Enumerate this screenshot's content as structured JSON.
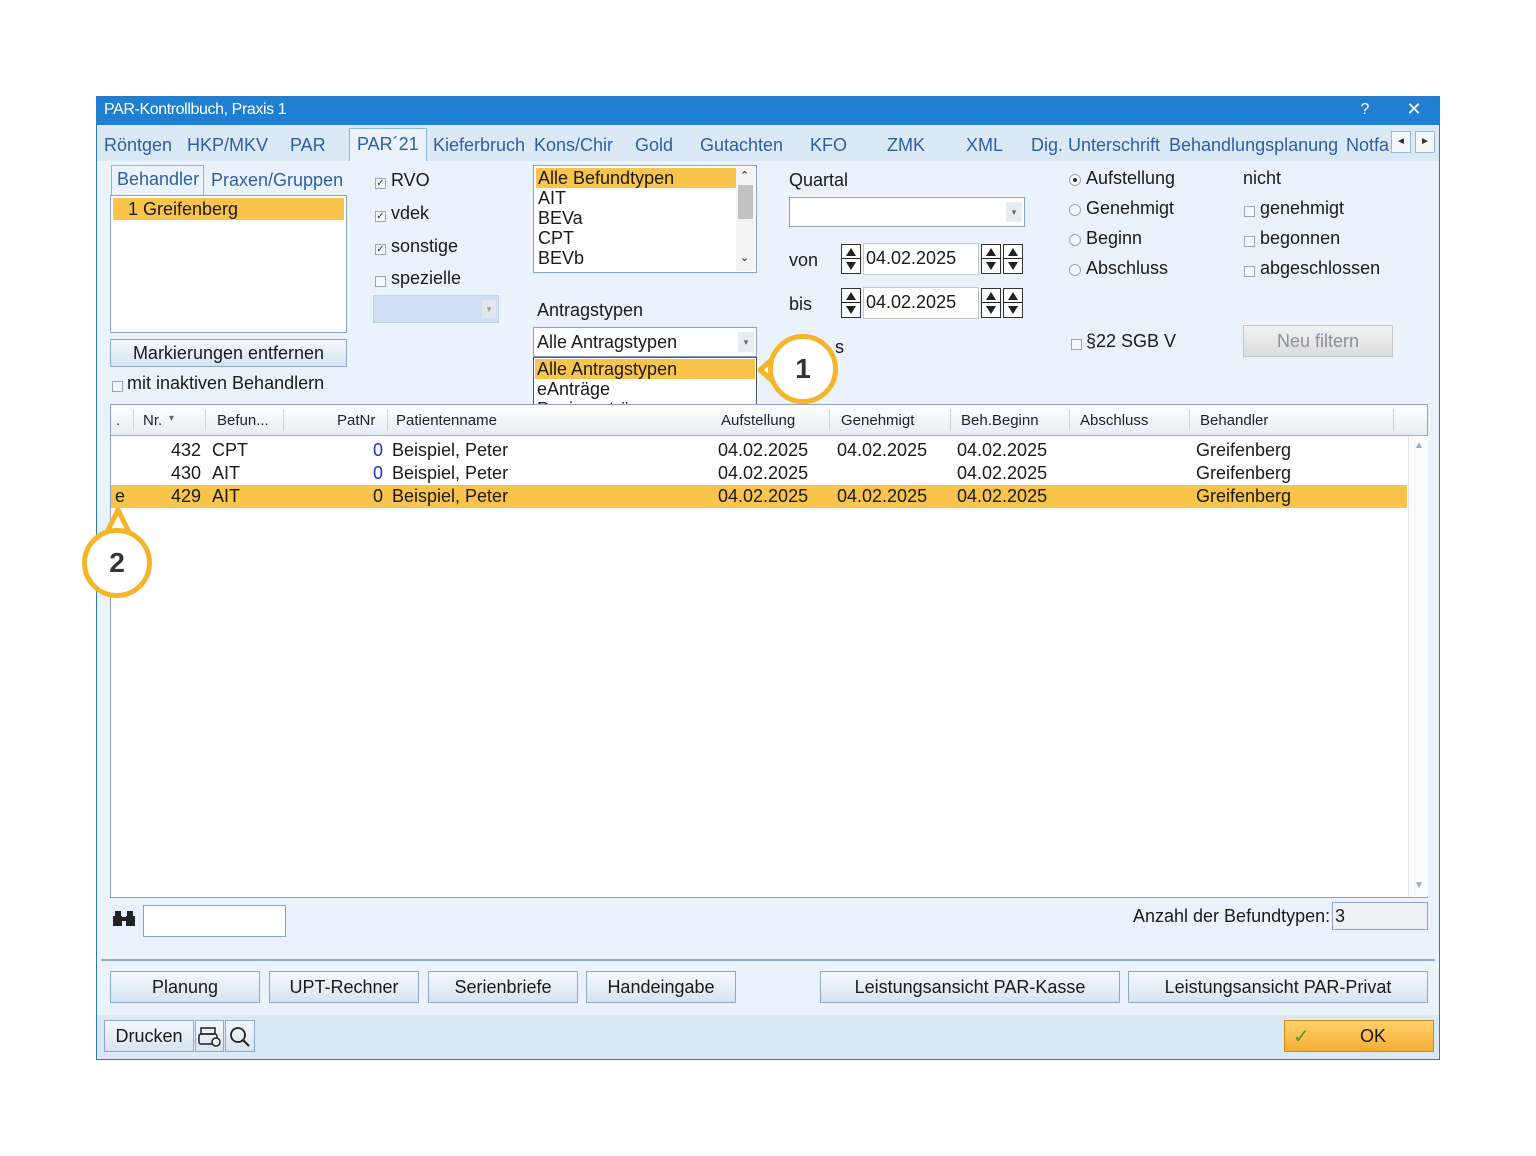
{
  "window": {
    "title": "PAR-Kontrollbuch, Praxis 1",
    "help": "?",
    "close": "✕"
  },
  "tabs": [
    "Röntgen",
    "HKP/MKV",
    "PAR",
    "PAR´21",
    "Kieferbruch",
    "Kons/Chir",
    "Gold",
    "Gutachten",
    "KFO",
    "ZMK",
    "XML",
    "Dig. Unterschrift",
    "Behandlungsplanung",
    "Notfa"
  ],
  "active_tab": "PAR´21",
  "left": {
    "tabs": [
      "Behandler",
      "Praxen/Gruppen"
    ],
    "behandler_list": [
      "1 Greifenberg"
    ],
    "remove_button": "Markierungen entfernen",
    "inactive_checkbox": "mit inaktiven Behandlern"
  },
  "kassen": [
    {
      "label": "RVO",
      "checked": true
    },
    {
      "label": "vdek",
      "checked": true
    },
    {
      "label": "sonstige",
      "checked": true
    },
    {
      "label": "spezielle",
      "checked": false
    }
  ],
  "befundtypen": [
    "Alle Befundtypen",
    "AIT",
    "BEVa",
    "CPT",
    "BEVb"
  ],
  "antragstypen": {
    "label": "Antragstypen",
    "selected": "Alle Antragstypen",
    "options": [
      "Alle Antragstypen",
      "eAnträge",
      "Papieranträge"
    ]
  },
  "zeitraum": {
    "quartal_label": "Quartal",
    "quartal_value": "",
    "von_label": "von",
    "von_value": "04.02.2025",
    "bis_label": "bis",
    "bis_value": "04.02.2025",
    "partial_label": "s"
  },
  "status_radios": [
    {
      "label": "Aufstellung",
      "selected": true
    },
    {
      "label": "Genehmigt",
      "selected": false
    },
    {
      "label": "Beginn",
      "selected": false
    },
    {
      "label": "Abschluss",
      "selected": false
    }
  ],
  "nicht": {
    "label": "nicht",
    "options": [
      "genehmigt",
      "begonnen",
      "abgeschlossen"
    ]
  },
  "sgb_checkbox": "§22 SGB V",
  "filter_button": "Neu filtern",
  "grid": {
    "columns": [
      ".",
      "Nr.",
      "Befun...",
      "PatNr",
      "Patientenname",
      "Aufstellung",
      "Genehmigt",
      "Beh.Beginn",
      "Abschluss",
      "Behandler"
    ],
    "rows": [
      {
        "mark": "",
        "nr": "432",
        "befund": "CPT",
        "patnr": "0",
        "name": "Beispiel, Peter",
        "aufstellung": "04.02.2025",
        "genehmigt": "04.02.2025",
        "beginn": "04.02.2025",
        "abschluss": "",
        "behandler": "Greifenberg",
        "selected": false
      },
      {
        "mark": "",
        "nr": "430",
        "befund": "AIT",
        "patnr": "0",
        "name": "Beispiel, Peter",
        "aufstellung": "04.02.2025",
        "genehmigt": "",
        "beginn": "04.02.2025",
        "abschluss": "",
        "behandler": "Greifenberg",
        "selected": false
      },
      {
        "mark": "e",
        "nr": "429",
        "befund": "AIT",
        "patnr": "0",
        "name": "Beispiel, Peter",
        "aufstellung": "04.02.2025",
        "genehmigt": "04.02.2025",
        "beginn": "04.02.2025",
        "abschluss": "",
        "behandler": "Greifenberg",
        "selected": true
      }
    ]
  },
  "search": {
    "value": ""
  },
  "count": {
    "label": "Anzahl der Befundtypen:",
    "value": "3"
  },
  "buttons": [
    "Planung",
    "UPT-Rechner",
    "Serienbriefe",
    "Handeingabe",
    "Leistungsansicht PAR-Kasse",
    "Leistungsansicht PAR-Privat"
  ],
  "footer": {
    "print": "Drucken",
    "ok": "OK"
  },
  "callouts": [
    "1",
    "2"
  ],
  "colors": {
    "titlebar": "#1f7fd3",
    "selection": "#f9c44b",
    "callout": "#f5b52b"
  }
}
